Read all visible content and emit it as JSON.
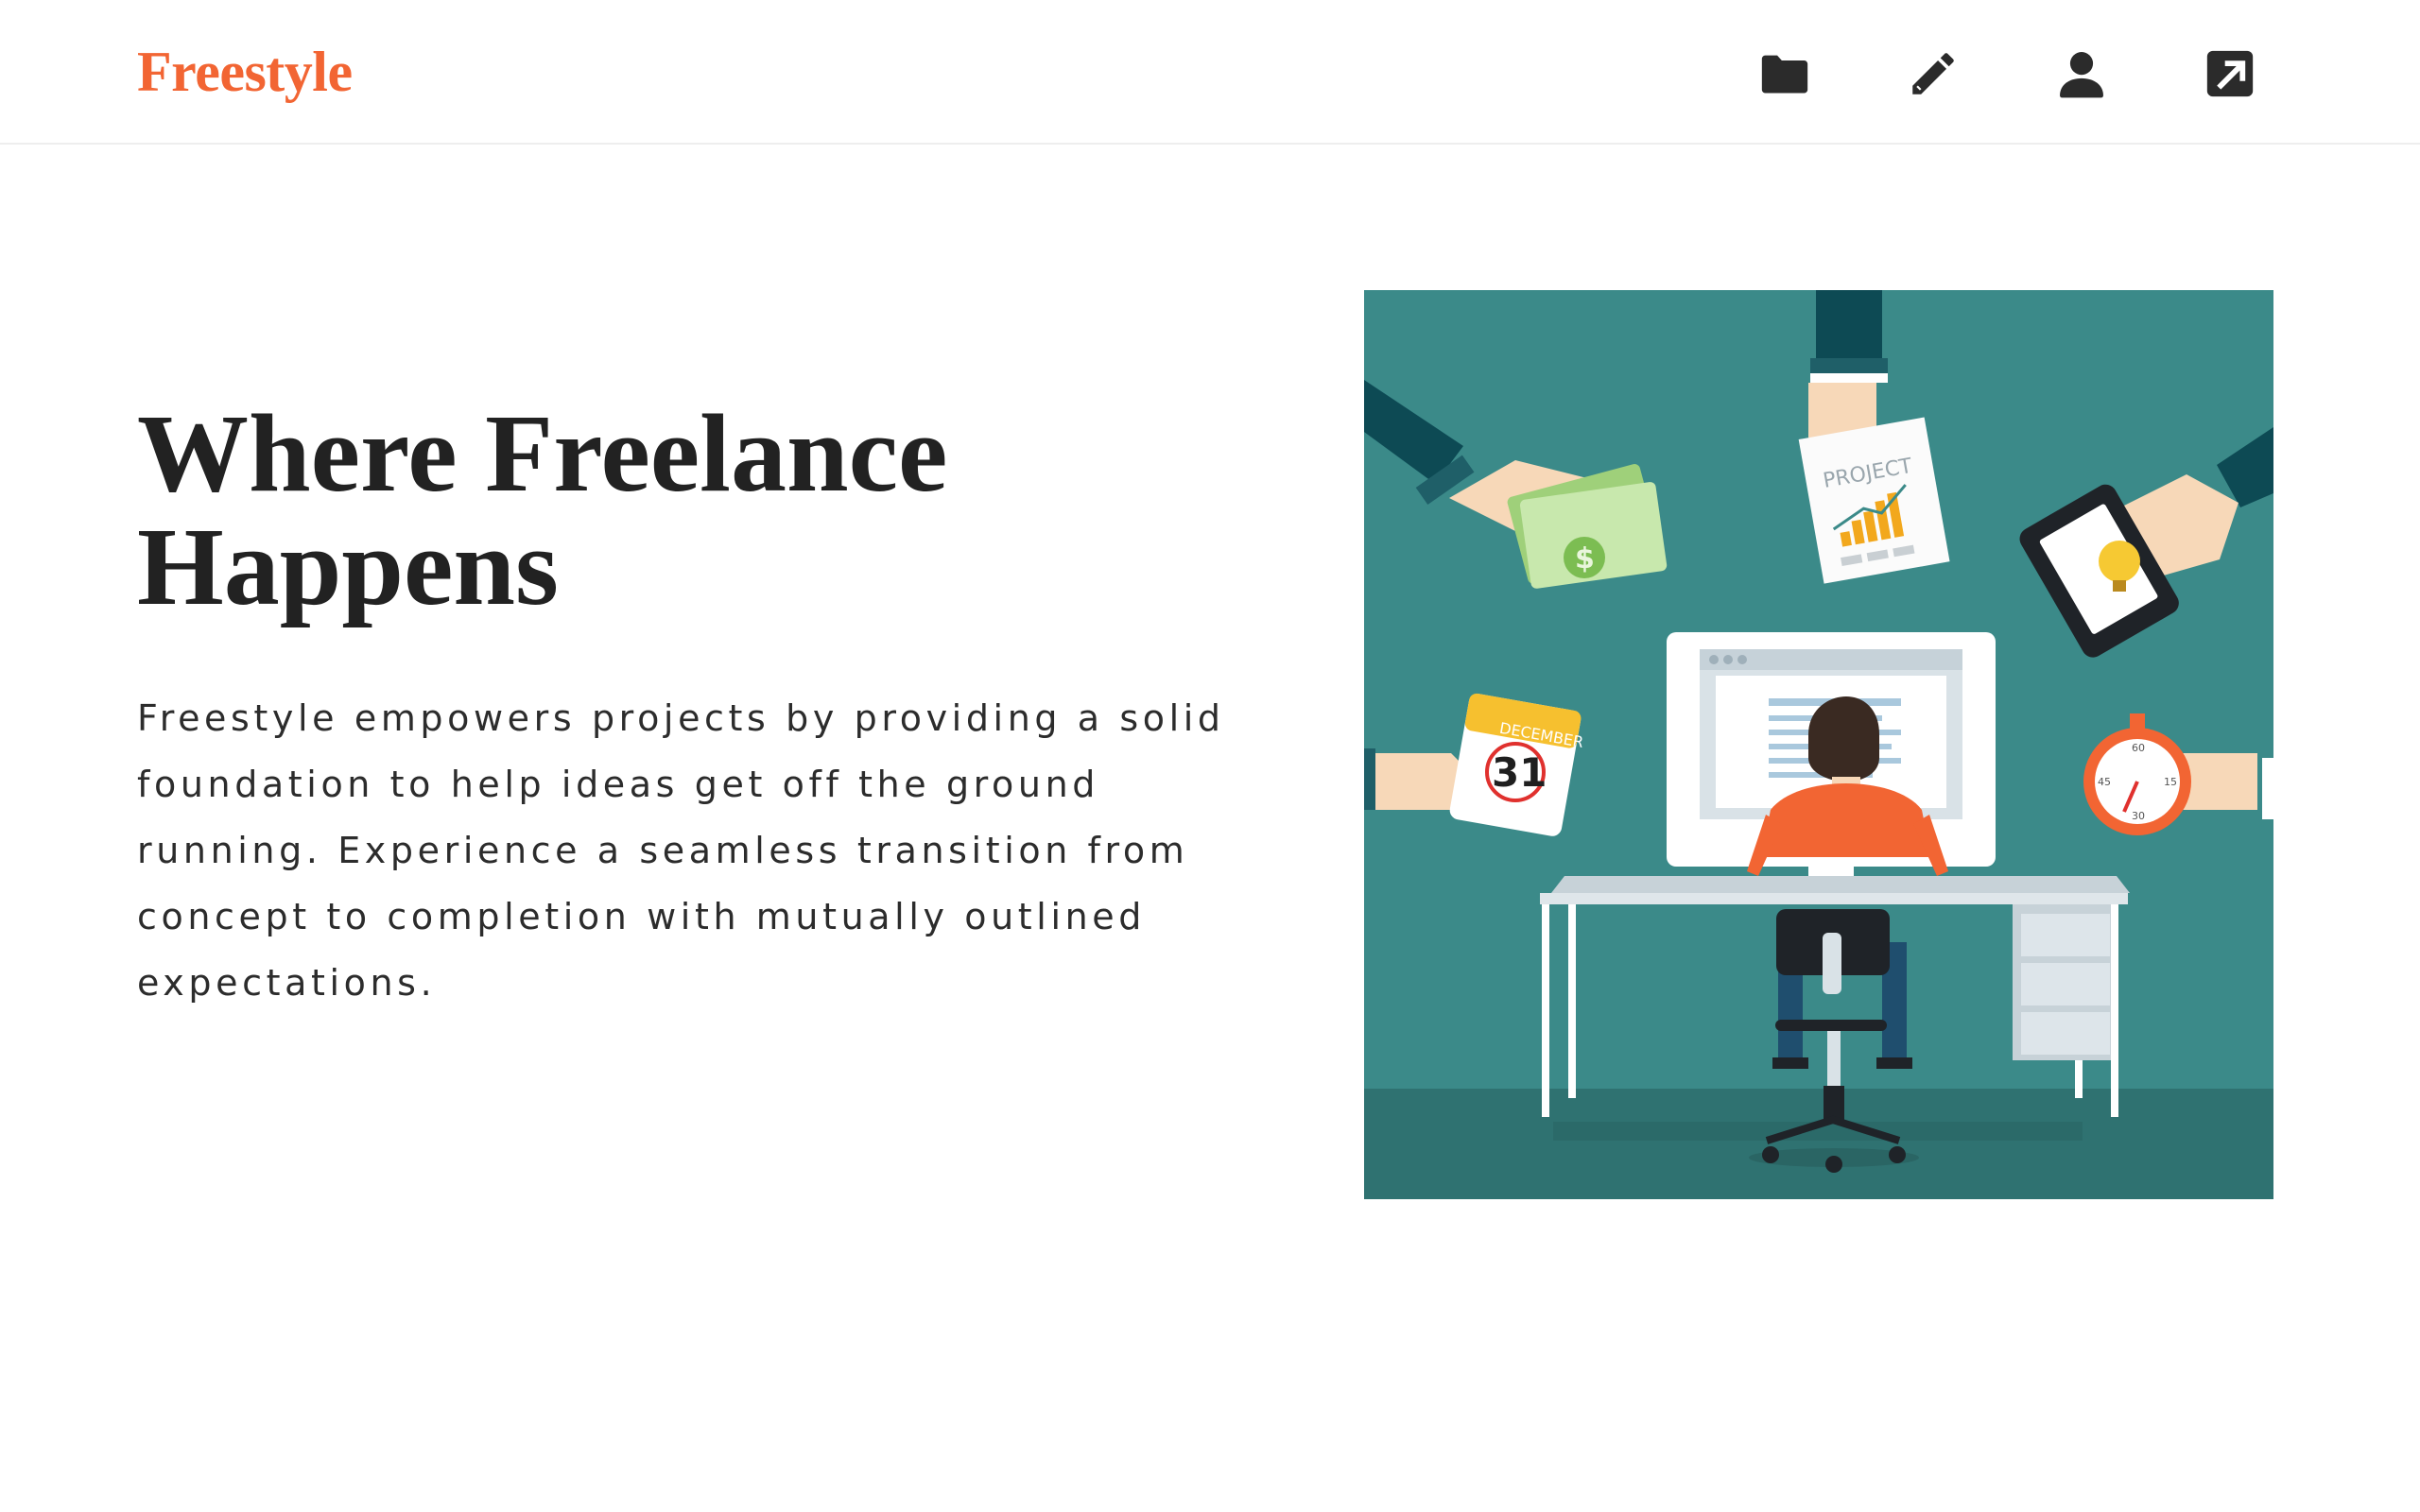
{
  "header": {
    "logo": "Freestyle",
    "nav": [
      {
        "icon": "folder-icon"
      },
      {
        "icon": "pencil-icon"
      },
      {
        "icon": "user-icon"
      },
      {
        "icon": "external-link-icon"
      }
    ]
  },
  "hero": {
    "headline": "Where Freelance Happens",
    "description": "Freestyle empowers projects by providing a solid foundation to help ideas get off the ground running. Experience a seamless transition from concept to completion with mutually outlined expectations.",
    "illustration": {
      "project_label": "PROJECT",
      "calendar_month": "DECEMBER",
      "calendar_day": "31",
      "currency_symbol": "$",
      "timer_60": "60",
      "timer_15": "15",
      "timer_30": "30",
      "timer_45": "45"
    }
  },
  "colors": {
    "brand": "#f26533",
    "text": "#222222",
    "illustration_bg": "#3b8a89"
  }
}
